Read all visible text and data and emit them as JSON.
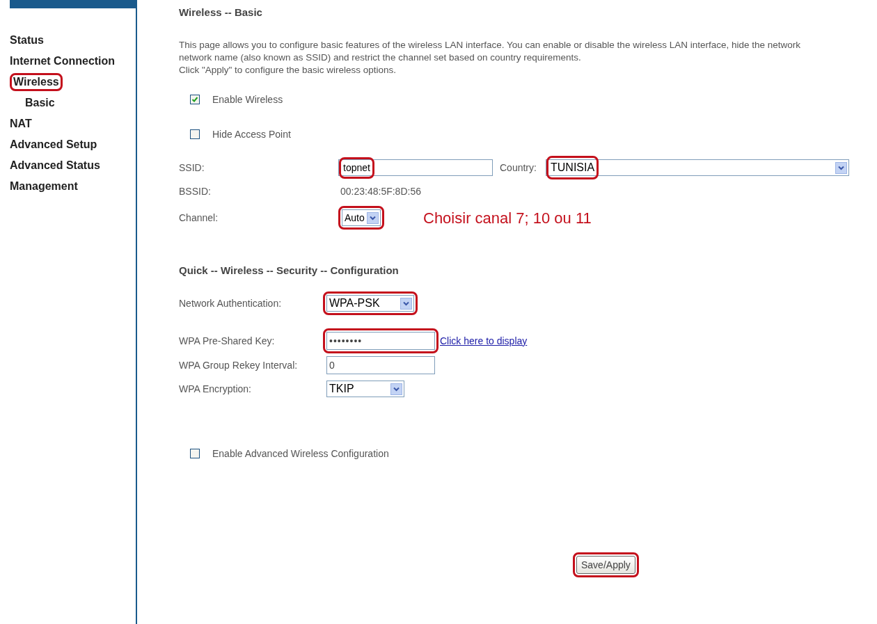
{
  "sidebar": {
    "items": [
      {
        "label": "Status",
        "highlighted": false
      },
      {
        "label": "Internet Connection",
        "highlighted": false
      },
      {
        "label": "Wireless",
        "highlighted": true,
        "children": [
          {
            "label": "Basic",
            "highlighted": false
          }
        ]
      },
      {
        "label": "NAT",
        "highlighted": false
      },
      {
        "label": "Advanced Setup",
        "highlighted": false
      },
      {
        "label": "Advanced Status",
        "highlighted": false
      },
      {
        "label": "Management",
        "highlighted": false
      }
    ]
  },
  "page": {
    "title": "Wireless -- Basic",
    "description": [
      "This page allows you to configure basic features of the wireless LAN interface. You can enable or disable the wireless LAN interface, hide the network",
      "network name (also known as SSID) and restrict the channel set based on country requirements.",
      "Click \"Apply\" to configure the basic wireless options."
    ],
    "checkboxes": [
      {
        "label": "Enable Wireless",
        "checked": true
      },
      {
        "label": "Hide Access Point",
        "checked": false
      }
    ],
    "ssid": {
      "label": "SSID:",
      "value": "topnet",
      "highlighted": true
    },
    "country": {
      "label": "Country:",
      "value": "TUNISIA",
      "highlighted": true
    },
    "bssid": {
      "label": "BSSID:",
      "value": "00:23:48:5F:8D:56"
    },
    "channel": {
      "label": "Channel:",
      "value": "Auto",
      "highlighted": true
    },
    "note": "Choisir canal 7; 10 ou 11"
  },
  "security": {
    "heading": "Quick -- Wireless -- Security -- Configuration",
    "fields": [
      {
        "kind": "select",
        "label": "Network Authentication:",
        "value": "WPA-PSK",
        "highlighted": true
      },
      {
        "kind": "password",
        "label": "WPA Pre-Shared Key:",
        "value": "••••••••",
        "highlighted": true,
        "link": "Click here to display"
      },
      {
        "kind": "text",
        "label": "WPA Group Rekey Interval:",
        "value": "0",
        "highlighted": false
      },
      {
        "kind": "select",
        "label": "WPA Encryption:",
        "value": "TKIP",
        "highlighted": false
      }
    ]
  },
  "advanced": {
    "label": "Enable Advanced Wireless Configuration",
    "checked": false
  },
  "button": {
    "label": "Save/Apply",
    "highlighted": true
  }
}
